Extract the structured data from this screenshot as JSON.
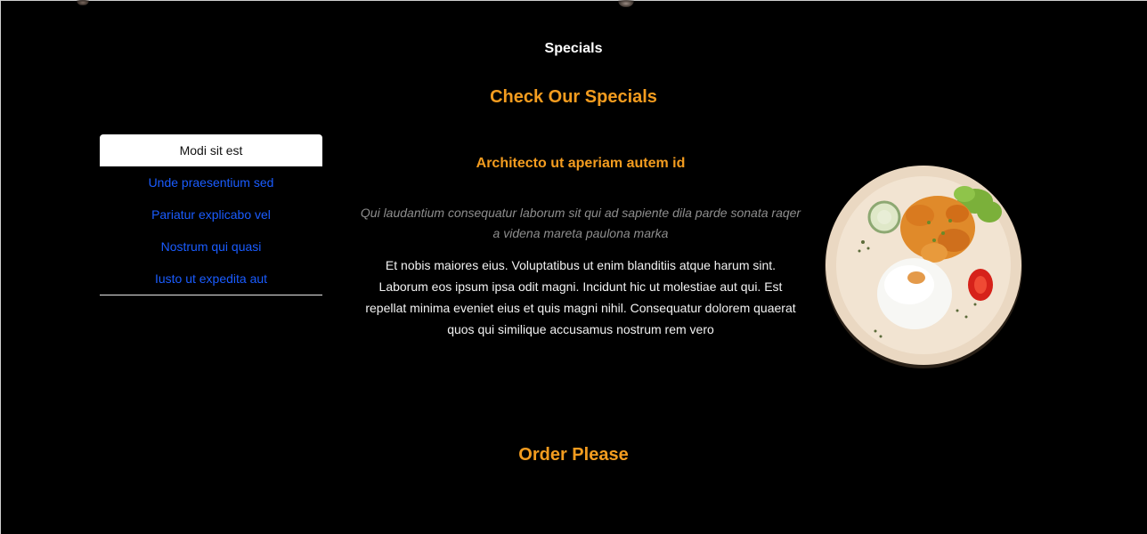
{
  "specials": {
    "section_label": "Specials",
    "title": "Check Our Specials",
    "tabs": [
      {
        "label": "Modi sit est",
        "active": true
      },
      {
        "label": "Unde praesentium sed",
        "active": false
      },
      {
        "label": "Pariatur explicabo vel",
        "active": false
      },
      {
        "label": "Nostrum qui quasi",
        "active": false
      },
      {
        "label": "Iusto ut expedita aut",
        "active": false
      }
    ],
    "dish": {
      "title": "Architecto ut aperiam autem id",
      "intro": "Qui laudantium consequatur laborum sit qui ad sapiente dila parde sonata raqer a videna mareta paulona marka",
      "description": "Et nobis maiores eius. Voluptatibus ut enim blanditiis atque harum sint. Laborum eos ipsum ipsa odit magni. Incidunt hic ut molestiae aut qui. Est repellat minima eveniet eius et quis magni nihil. Consequatur dolorem quaerat quos qui similique accusamus nostrum rem vero",
      "image_icon": "food-plate-image"
    }
  },
  "order": {
    "title": "Order Please"
  },
  "colors": {
    "background": "#000000",
    "accent": "#f39c1f",
    "link": "#1a5cff",
    "text": "#f2f2f2",
    "muted": "#8e8e8e"
  }
}
